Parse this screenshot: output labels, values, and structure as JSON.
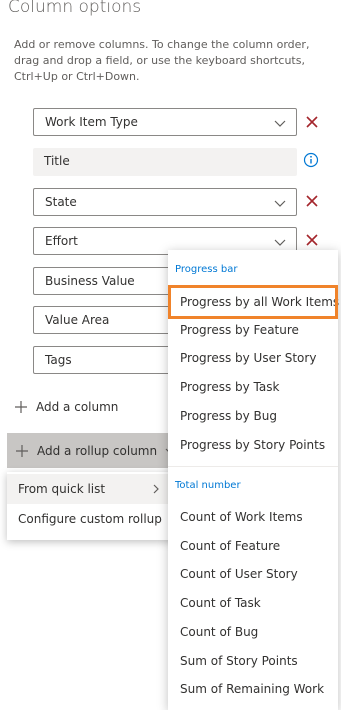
{
  "panel": {
    "title": "Column options",
    "description": "Add or remove columns. To change the column order, drag and drop a field, or use the keyboard shortcuts, Ctrl+Up or Ctrl+Down."
  },
  "columns": [
    {
      "label": "Work Item Type",
      "removable": true,
      "dropdown": true
    },
    {
      "label": "Title",
      "removable": false,
      "dropdown": false,
      "readonly": true
    },
    {
      "label": "State",
      "removable": true,
      "dropdown": true
    },
    {
      "label": "Effort",
      "removable": true,
      "dropdown": true
    },
    {
      "label": "Business Value",
      "removable": true,
      "dropdown": true
    },
    {
      "label": "Value Area",
      "removable": true,
      "dropdown": true
    },
    {
      "label": "Tags",
      "removable": true,
      "dropdown": true
    }
  ],
  "actions": {
    "add_column": "Add a column",
    "add_rollup": "Add a rollup column"
  },
  "rollup_menu": {
    "items": [
      "From quick list",
      "Configure custom rollup"
    ]
  },
  "flyout": {
    "progress_header": "Progress bar",
    "progress_items": [
      "Progress by all Work Items",
      "Progress by Feature",
      "Progress by User Story",
      "Progress by Task",
      "Progress by Bug",
      "Progress by Story Points"
    ],
    "total_header": "Total number",
    "total_items": [
      "Count of Work Items",
      "Count of Feature",
      "Count of User Story",
      "Count of Task",
      "Count of Bug",
      "Sum of Story Points",
      "Sum of Remaining Work"
    ]
  },
  "colors": {
    "accent": "#0078d4",
    "remove": "#a4262c",
    "highlight": "#f0832a"
  },
  "icons": [
    "chevron-down-icon",
    "close-icon",
    "info-icon",
    "plus-icon",
    "chevron-right-icon"
  ]
}
